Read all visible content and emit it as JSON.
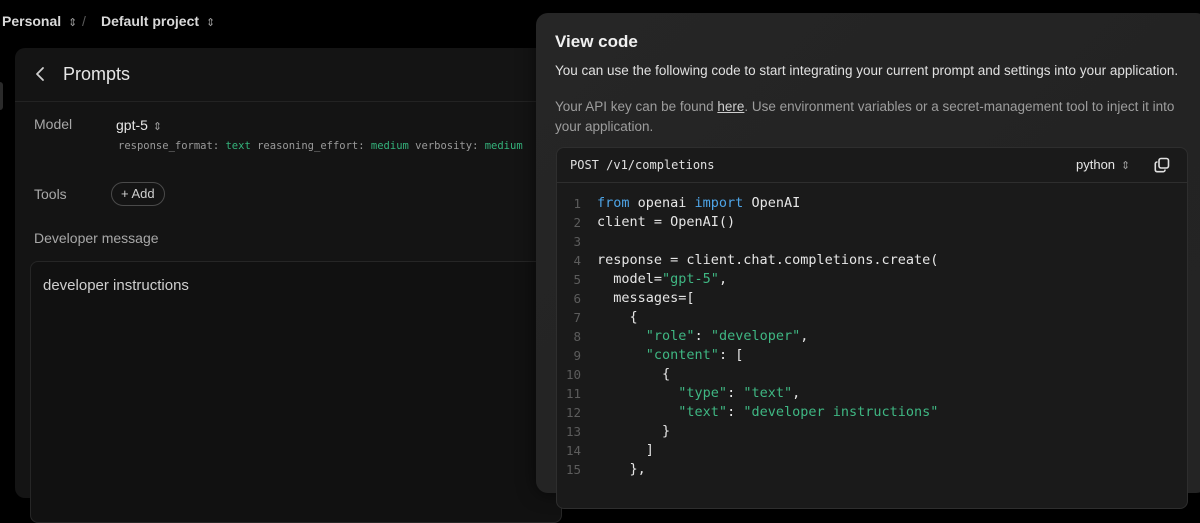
{
  "breadcrumb": {
    "org": "Personal",
    "project": "Default project",
    "separator": "/"
  },
  "panel": {
    "title": "Prompts",
    "model": {
      "label": "Model",
      "value": "gpt-5",
      "params": [
        {
          "key": "response_format:",
          "value": "text"
        },
        {
          "key": "reasoning_effort:",
          "value": "medium"
        },
        {
          "key": "verbosity:",
          "value": "medium"
        }
      ]
    },
    "tools": {
      "label": "Tools",
      "add_label": "+ Add"
    },
    "developer": {
      "label": "Developer message",
      "value": "developer instructions"
    }
  },
  "modal": {
    "title": "View code",
    "description": "You can use the following code to start integrating your current prompt and settings into your application.",
    "note_before": "Your API key can be found ",
    "note_link": "here",
    "note_after": ". Use environment variables or a secret-management tool to inject it into your application.",
    "endpoint": "POST /v1/completions",
    "language": "python",
    "code": [
      {
        "n": "1",
        "parts": [
          [
            "kw",
            "from"
          ],
          [
            "t",
            " openai "
          ],
          [
            "kw",
            "import"
          ],
          [
            "t",
            " OpenAI"
          ]
        ]
      },
      {
        "n": "2",
        "parts": [
          [
            "t",
            "client = OpenAI()"
          ]
        ]
      },
      {
        "n": "3",
        "parts": []
      },
      {
        "n": "4",
        "parts": [
          [
            "t",
            "response = client.chat.completions.create("
          ]
        ]
      },
      {
        "n": "5",
        "parts": [
          [
            "t",
            "  model="
          ],
          [
            "str",
            "\"gpt-5\""
          ],
          [
            "t",
            ","
          ]
        ]
      },
      {
        "n": "6",
        "parts": [
          [
            "t",
            "  messages=["
          ]
        ]
      },
      {
        "n": "7",
        "parts": [
          [
            "t",
            "    {"
          ]
        ]
      },
      {
        "n": "8",
        "parts": [
          [
            "t",
            "      "
          ],
          [
            "str",
            "\"role\""
          ],
          [
            "t",
            ": "
          ],
          [
            "str",
            "\"developer\""
          ],
          [
            "t",
            ","
          ]
        ]
      },
      {
        "n": "9",
        "parts": [
          [
            "t",
            "      "
          ],
          [
            "str",
            "\"content\""
          ],
          [
            "t",
            ": ["
          ]
        ]
      },
      {
        "n": "10",
        "parts": [
          [
            "t",
            "        {"
          ]
        ]
      },
      {
        "n": "11",
        "parts": [
          [
            "t",
            "          "
          ],
          [
            "str",
            "\"type\""
          ],
          [
            "t",
            ": "
          ],
          [
            "str",
            "\"text\""
          ],
          [
            "t",
            ","
          ]
        ]
      },
      {
        "n": "12",
        "parts": [
          [
            "t",
            "          "
          ],
          [
            "str",
            "\"text\""
          ],
          [
            "t",
            ": "
          ],
          [
            "str",
            "\"developer instructions\""
          ]
        ]
      },
      {
        "n": "13",
        "parts": [
          [
            "t",
            "        }"
          ]
        ]
      },
      {
        "n": "14",
        "parts": [
          [
            "t",
            "      ]"
          ]
        ]
      },
      {
        "n": "15",
        "parts": [
          [
            "t",
            "    },"
          ]
        ]
      }
    ]
  },
  "colors": {
    "keyword": "#4ea4e6",
    "string": "#3fb783",
    "background": "#000000",
    "modal": "#242424"
  }
}
